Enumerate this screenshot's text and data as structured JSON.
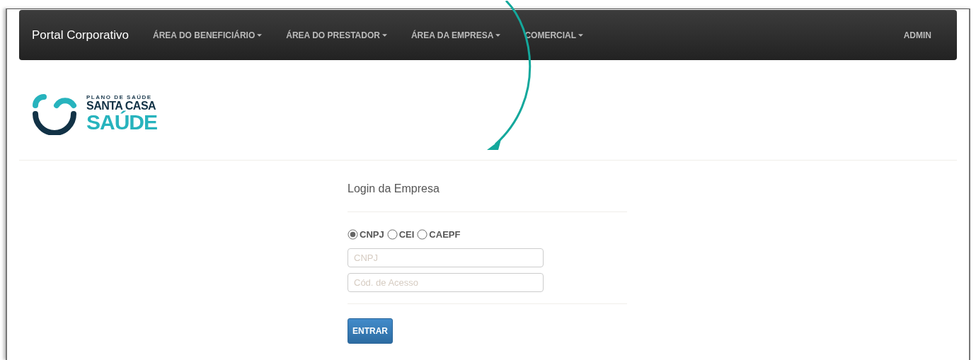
{
  "navbar": {
    "brand": "Portal Corporativo",
    "menus": [
      {
        "label": "ÁREA DO BENEFICIÁRIO",
        "caret": true
      },
      {
        "label": "ÁREA DO PRESTADOR",
        "caret": true
      },
      {
        "label": "ÁREA DA EMPRESA",
        "caret": true
      },
      {
        "label": "COMERCIAL",
        "caret": true
      }
    ],
    "right": "ADMIN"
  },
  "logo": {
    "tagline": "PLANO DE SAÚDE",
    "line1": "SANTA CASA",
    "line2": "SAÚDE"
  },
  "login": {
    "title": "Login da Empresa",
    "doc_types": [
      {
        "label": "CNPJ",
        "selected": true
      },
      {
        "label": "CEI",
        "selected": false
      },
      {
        "label": "CAEPF",
        "selected": false
      }
    ],
    "fields": [
      {
        "placeholder": "CNPJ"
      },
      {
        "placeholder": "Cód. de Acesso"
      }
    ],
    "submit": "ENTRAR"
  }
}
